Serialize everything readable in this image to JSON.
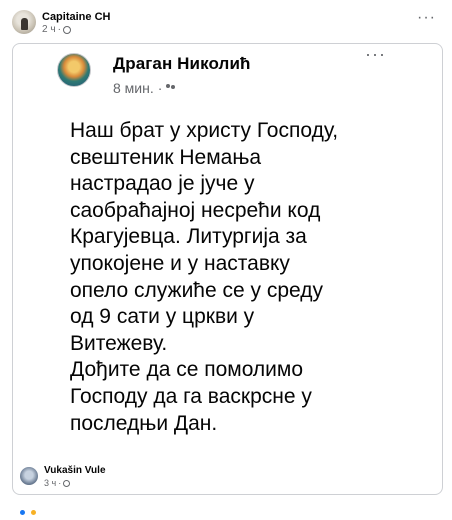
{
  "outer_post": {
    "author": "Capitaine CH",
    "time": "2 ч",
    "more_icon": "more-horizontal-icon"
  },
  "shared_post": {
    "author": "Драган Николић",
    "time": "8 мин.",
    "privacy_icon": "friends-icon",
    "more_icon": "more-horizontal-icon",
    "body": "Наш брат у христу Господу,\nсвештеник Немања\nнастрадао је јуче у\nсаобраћајној несрећи код\nКрагујевца. Литургија за\nупокојене и у наставку\nопело служиће се у среду\nод 9 сати у цркви у\nВитежеву.\n Дођите да се помолимо\nГосподу да га васкрсне у\nпоследњи Дан."
  },
  "comment": {
    "author": "Vukašin Vule",
    "time": "3 ч"
  },
  "colors": {
    "text": "#050505",
    "secondary": "#65676b",
    "border": "#ced0d4",
    "background": "#ffffff"
  }
}
